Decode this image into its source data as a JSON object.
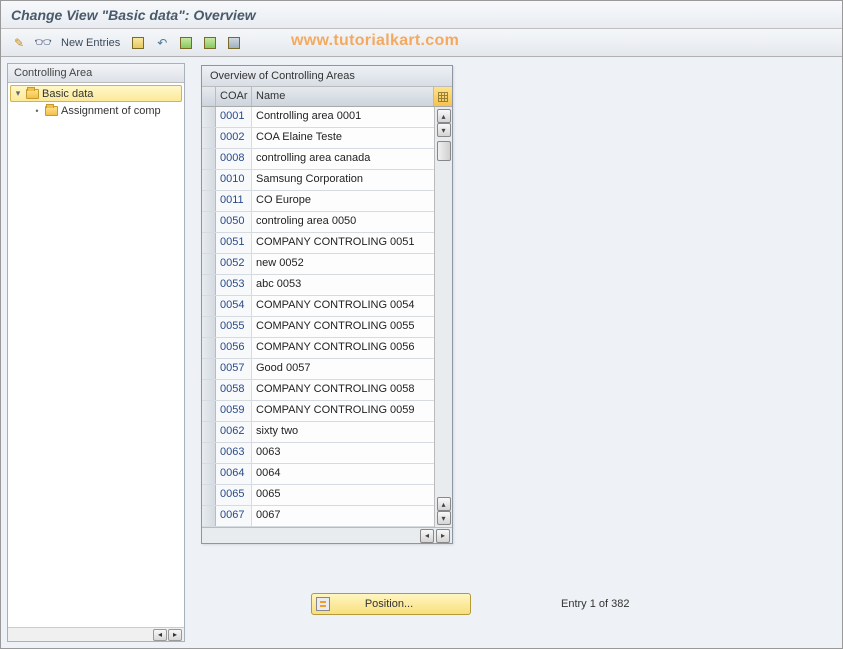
{
  "title": "Change View \"Basic data\": Overview",
  "toolbar": {
    "new_entries": "New Entries"
  },
  "watermark": "www.tutorialkart.com",
  "tree": {
    "header": "Controlling Area",
    "node1": "Basic data",
    "node2": "Assignment of comp"
  },
  "table": {
    "title": "Overview of Controlling Areas",
    "col_coar": "COAr",
    "col_name": "Name",
    "rows": [
      {
        "coar": "0001",
        "name": "Controlling area 0001"
      },
      {
        "coar": "0002",
        "name": "COA Elaine Teste"
      },
      {
        "coar": "0008",
        "name": "controlling area canada"
      },
      {
        "coar": "0010",
        "name": "Samsung Corporation"
      },
      {
        "coar": "0011",
        "name": "CO Europe"
      },
      {
        "coar": "0050",
        "name": "controling area 0050"
      },
      {
        "coar": "0051",
        "name": "COMPANY CONTROLING 0051"
      },
      {
        "coar": "0052",
        "name": "new 0052"
      },
      {
        "coar": "0053",
        "name": "abc 0053"
      },
      {
        "coar": "0054",
        "name": "COMPANY CONTROLING 0054"
      },
      {
        "coar": "0055",
        "name": "COMPANY CONTROLING 0055"
      },
      {
        "coar": "0056",
        "name": "COMPANY CONTROLING 0056"
      },
      {
        "coar": "0057",
        "name": "Good 0057"
      },
      {
        "coar": "0058",
        "name": "COMPANY CONTROLING 0058"
      },
      {
        "coar": "0059",
        "name": "COMPANY CONTROLING 0059"
      },
      {
        "coar": "0062",
        "name": "sixty two"
      },
      {
        "coar": "0063",
        "name": "0063"
      },
      {
        "coar": "0064",
        "name": "0064"
      },
      {
        "coar": "0065",
        "name": "0065"
      },
      {
        "coar": "0067",
        "name": "0067"
      }
    ]
  },
  "footer": {
    "position_label": "Position...",
    "status": "Entry 1 of 382"
  }
}
